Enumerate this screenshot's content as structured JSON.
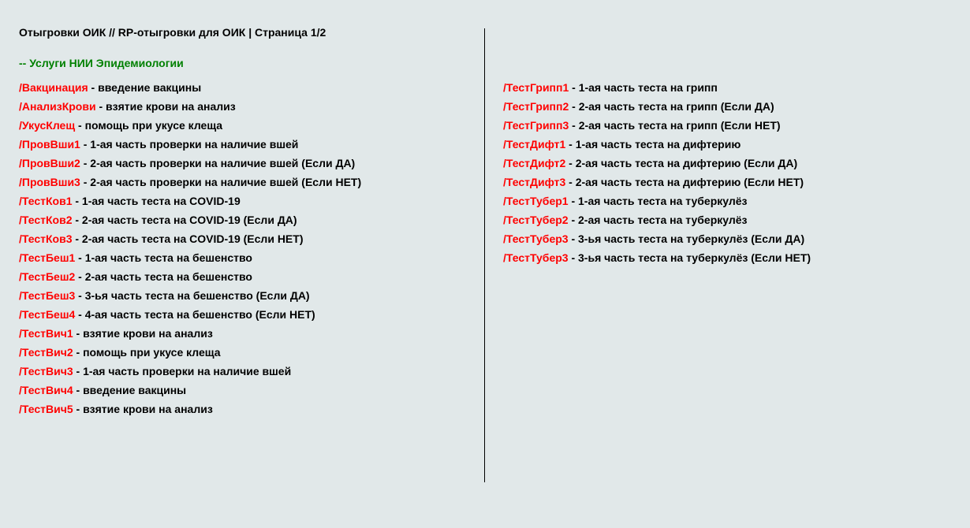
{
  "header": {
    "title": "Отыгровки ОИК // RP-отыгровки для ОИК | Страница 1/2",
    "section_title": "-- Услуги НИИ Эпидемиологии"
  },
  "colors": {
    "background": "#e1e8e9",
    "command": "#ff0000",
    "section": "#008000",
    "text": "#000000"
  },
  "left_column": [
    {
      "cmd": "/Вакцинация",
      "desc": " - введение вакцины"
    },
    {
      "cmd": "/АнализКрови",
      "desc": " - взятие крови на анализ"
    },
    {
      "cmd": "/УкусКлещ",
      "desc": " - помощь при укусе клеща"
    },
    {
      "cmd": "/ПровВши1",
      "desc": " - 1-ая часть проверки на наличие вшей"
    },
    {
      "cmd": "/ПровВши2",
      "desc": " - 2-ая часть проверки на наличие вшей (Если ДА)"
    },
    {
      "cmd": "/ПровВши3",
      "desc": " - 2-ая часть проверки на наличие вшей (Если НЕТ)"
    },
    {
      "cmd": "/ТестКов1",
      "desc": " - 1-ая часть теста на COVID-19"
    },
    {
      "cmd": "/ТестКов2",
      "desc": " - 2-ая часть теста на COVID-19 (Если ДА)"
    },
    {
      "cmd": "/ТестКов3",
      "desc": " - 2-ая часть теста на COVID-19 (Если НЕТ)"
    },
    {
      "cmd": "/ТестБеш1",
      "desc": " - 1-ая часть теста на бешенство"
    },
    {
      "cmd": "/ТестБеш2",
      "desc": " - 2-ая часть теста на бешенство"
    },
    {
      "cmd": "/ТестБеш3",
      "desc": " - 3-ья часть теста на бешенство (Если ДА)"
    },
    {
      "cmd": "/ТестБеш4",
      "desc": " - 4-ая часть теста на бешенство (Если НЕТ)"
    },
    {
      "cmd": "/ТестВич1",
      "desc": " - взятие крови на анализ"
    },
    {
      "cmd": "/ТестВич2",
      "desc": " - помощь при укусе клеща"
    },
    {
      "cmd": "/ТестВич3",
      "desc": " - 1-ая часть проверки на наличие вшей"
    },
    {
      "cmd": "/ТестВич4",
      "desc": " - введение вакцины"
    },
    {
      "cmd": "/ТестВич5",
      "desc": " - взятие крови на анализ"
    }
  ],
  "right_column": [
    {
      "cmd": "/ТестГрипп1",
      "desc": " - 1-ая часть теста на грипп"
    },
    {
      "cmd": "/ТестГрипп2",
      "desc": " - 2-ая часть теста на грипп (Если ДА)"
    },
    {
      "cmd": "/ТестГрипп3",
      "desc": " - 2-ая часть теста на грипп (Если НЕТ)"
    },
    {
      "cmd": "/ТестДифт1",
      "desc": " - 1-ая часть теста на дифтерию"
    },
    {
      "cmd": "/ТестДифт2",
      "desc": " - 2-ая часть теста на дифтерию (Если ДА)"
    },
    {
      "cmd": "/ТестДифт3",
      "desc": " - 2-ая часть теста на дифтерию (Если НЕТ)"
    },
    {
      "cmd": "/ТестТубер1",
      "desc": " - 1-ая часть теста на туберкулёз"
    },
    {
      "cmd": "/ТестТубер2",
      "desc": " - 2-ая часть теста на туберкулёз"
    },
    {
      "cmd": "/ТестТубер3",
      "desc": " - 3-ья часть теста на туберкулёз (Если ДА)"
    },
    {
      "cmd": "/ТестТубер3",
      "desc": " - 3-ья часть теста на туберкулёз (Если НЕТ)"
    }
  ]
}
